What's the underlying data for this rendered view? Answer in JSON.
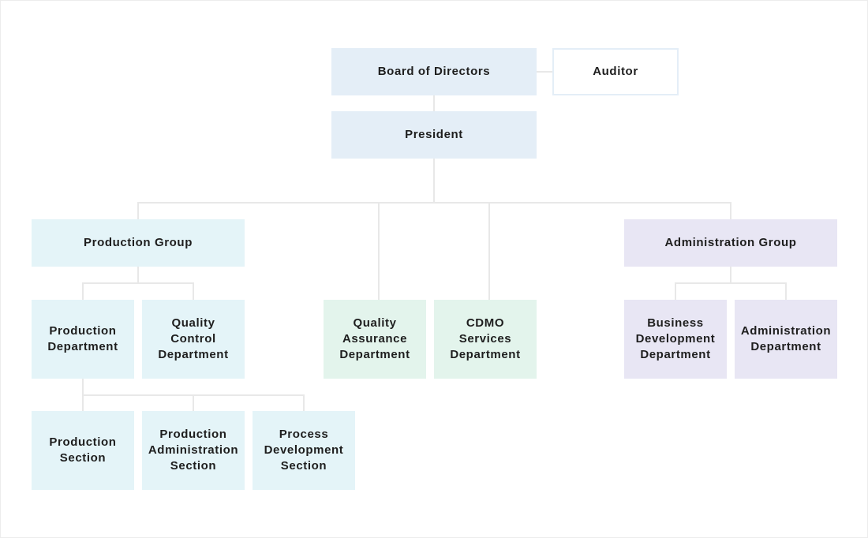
{
  "chart": {
    "title": "",
    "nodes": {
      "board": "Board of Directors",
      "auditor": "Auditor",
      "president": "President",
      "production_group": "Production Group",
      "administration_group": "Administration Group",
      "production_department": "Production\nDepartment",
      "quality_control_department": "Quality\nControl\nDepartment",
      "quality_assurance_department": "Quality\nAssurance\nDepartment",
      "cdmo_services_department": "CDMO\nServices\nDepartment",
      "business_development_department": "Business\nDevelopment\nDepartment",
      "administration_department": "Administration\nDepartment",
      "production_section": "Production\nSection",
      "production_administration_section": "Production\nAdministration\nSection",
      "process_development_section": "Process\nDevelopment\nSection"
    },
    "colors": {
      "executive": "#e4eef7",
      "production": "#e4f4f8",
      "quality_cdmo": "#e3f4ec",
      "administration": "#e8e6f4",
      "connector": "#e8e8e8"
    }
  }
}
